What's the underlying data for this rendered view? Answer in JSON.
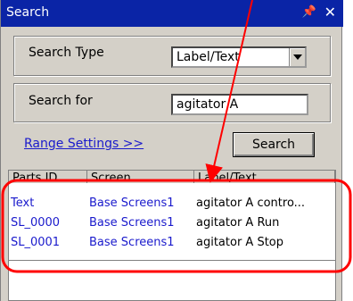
{
  "window": {
    "title": "Search",
    "pin_glyph": "❀",
    "close_glyph": "✕"
  },
  "search_type": {
    "label": "Search Type",
    "selected": "Label/Text"
  },
  "search_for": {
    "label": "Search for",
    "value": "agitator A"
  },
  "range_settings": {
    "label": "Range Settings >>"
  },
  "search_button": {
    "label": "Search"
  },
  "results": {
    "columns": [
      "Parts ID",
      "Screen",
      "Label/Text"
    ],
    "rows": [
      [
        "Text",
        "Base Screens1",
        "agitator A contro..."
      ],
      [
        "SL_0000",
        "Base Screens1",
        "agitator A Run"
      ],
      [
        "SL_0001",
        "Base Screens1",
        "agitator A Stop"
      ]
    ]
  },
  "colors": {
    "titlebar": "#0a24a6",
    "panel": "#d4d0c8",
    "link": "#1a1acc",
    "highlight": "#ff0000"
  }
}
